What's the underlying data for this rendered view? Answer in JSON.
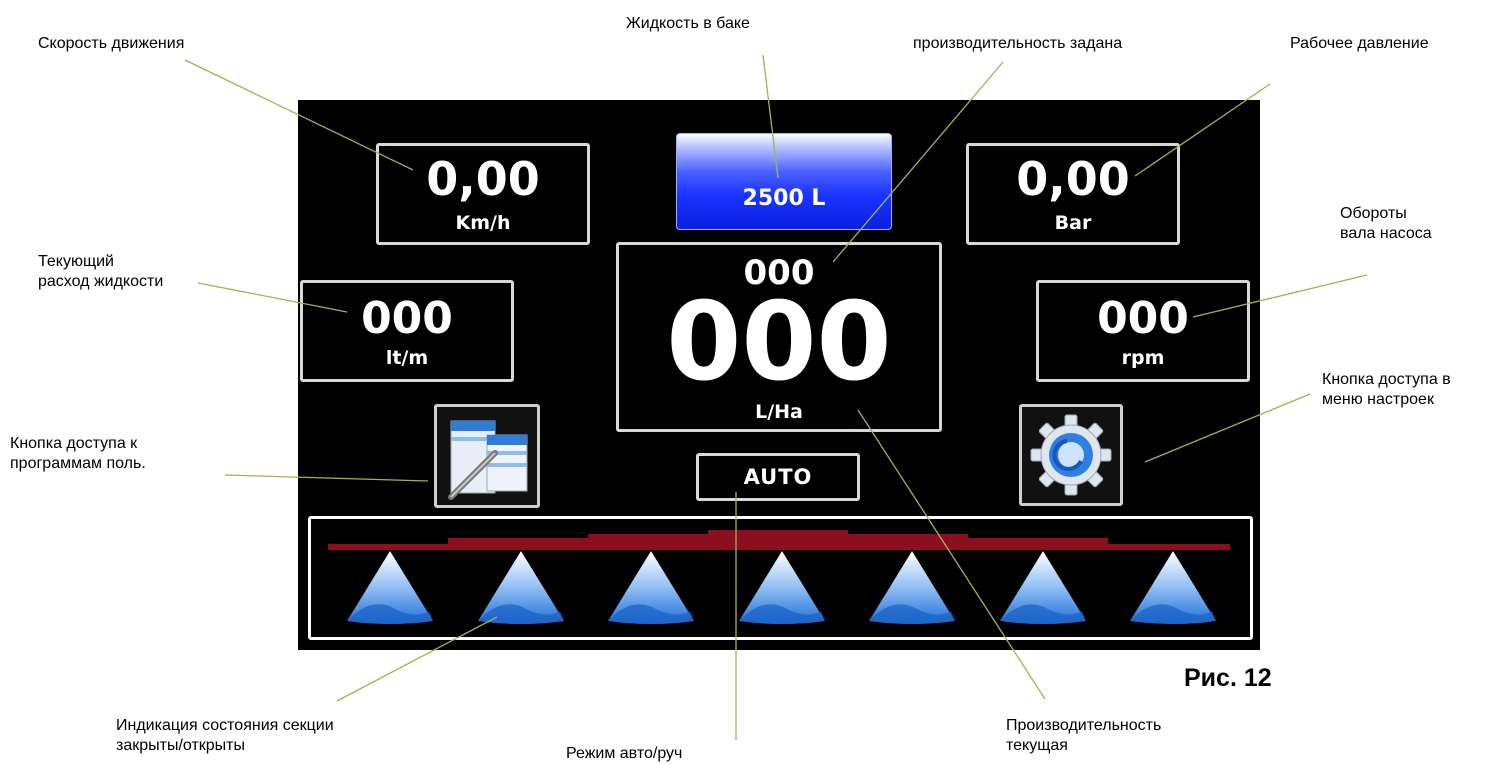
{
  "labels": {
    "speed": "Скорость движения",
    "tank": "Жидкость в баке",
    "rate_set": "производительность задана",
    "pressure": "Рабочее давление",
    "pump_rpm_l1": "Обороты",
    "pump_rpm_l2": "вала насоса",
    "flow_l1": "Текующий",
    "flow_l2": "расход жидкости",
    "programs_l1": "Кнопка доступа к",
    "programs_l2": "программам поль.",
    "settings_l1": "Кнопка доступа в",
    "settings_l2": "меню настроек",
    "sections_l1": "Индикация состояния секции",
    "sections_l2": "закрыты/открыты",
    "mode": "Режим авто/руч",
    "rate_cur_l1": "Производительность",
    "rate_cur_l2": "текущая",
    "figure": "Рис. 12"
  },
  "display": {
    "speed": {
      "value": "0,00",
      "unit": "Km/h"
    },
    "tank": {
      "value": "2500 L"
    },
    "pressure": {
      "value": "0,00",
      "unit": "Bar"
    },
    "flow": {
      "value": "000",
      "unit": "lt/m"
    },
    "rpm": {
      "value": "000",
      "unit": "rpm"
    },
    "rate": {
      "set": "000",
      "current": "000",
      "unit": "L/Ha"
    },
    "mode": "AUTO",
    "sections_count": 7
  },
  "colors": {
    "screen_bg": "#000000",
    "tank_blue": "#1a33ff",
    "boom_bar": "#8b0f1e",
    "leader_line": "#9ab84a",
    "nozzle_blue": "#2f7fe0"
  },
  "icons": {
    "programs": "document-pencil-icon",
    "settings": "gear-icon",
    "section": "nozzle-triangle-icon"
  }
}
